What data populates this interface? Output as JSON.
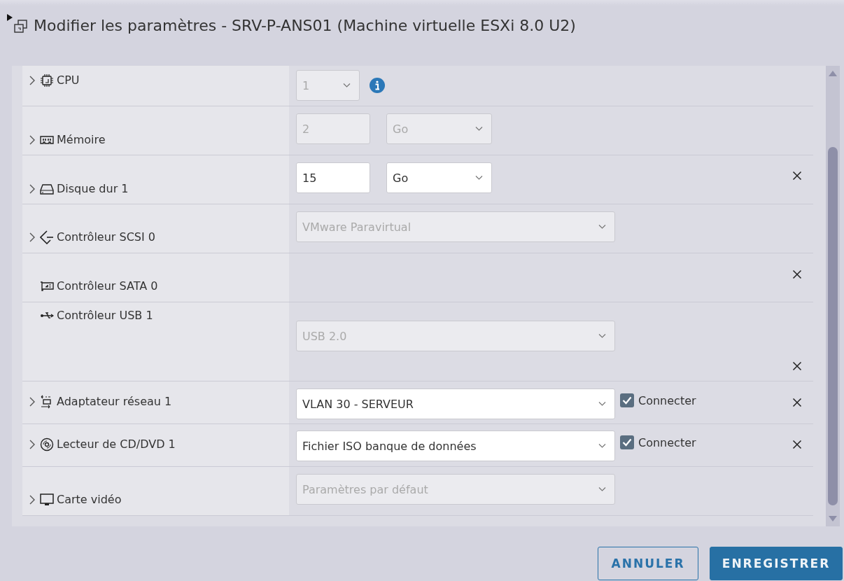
{
  "dialog": {
    "title": "Modifier les paramètres - SRV-P-ANS01 (Machine virtuelle ESXi 8.0 U2)"
  },
  "rows": [
    {
      "label": "CPU",
      "expandable": true,
      "removable": false,
      "controls": [
        {
          "kind": "select",
          "value": "1",
          "disabled": true
        },
        {
          "kind": "info"
        }
      ]
    },
    {
      "label": "Mémoire",
      "expandable": true,
      "removable": false,
      "controls": [
        {
          "kind": "input",
          "value": "2",
          "disabled": true
        },
        {
          "kind": "select",
          "value": "Go",
          "disabled": true
        }
      ]
    },
    {
      "label": "Disque dur 1",
      "expandable": true,
      "removable": true,
      "controls": [
        {
          "kind": "input",
          "value": "15",
          "disabled": false
        },
        {
          "kind": "select",
          "value": "Go",
          "disabled": false
        }
      ]
    },
    {
      "label": "Contrôleur SCSI 0",
      "expandable": true,
      "removable": false,
      "controls": [
        {
          "kind": "select",
          "value": "VMware Paravirtual",
          "disabled": true
        }
      ]
    },
    {
      "label": "Contrôleur SATA 0",
      "expandable": false,
      "removable": true,
      "controls": []
    },
    {
      "label": "Contrôleur USB 1",
      "expandable": false,
      "removable": true,
      "controls": [
        {
          "kind": "select",
          "value": "USB 2.0",
          "disabled": true
        }
      ]
    },
    {
      "label": "Adaptateur réseau 1",
      "expandable": true,
      "removable": true,
      "controls": [
        {
          "kind": "select",
          "value": "VLAN 30 - SERVEUR",
          "disabled": false
        },
        {
          "kind": "checkbox",
          "label": "Connecter",
          "checked": true
        }
      ]
    },
    {
      "label": "Lecteur de CD/DVD 1",
      "expandable": true,
      "removable": true,
      "controls": [
        {
          "kind": "select",
          "value": "Fichier ISO banque de données",
          "disabled": false
        },
        {
          "kind": "checkbox",
          "label": "Connecter",
          "checked": true
        }
      ]
    },
    {
      "label": "Carte vidéo",
      "expandable": true,
      "removable": false,
      "controls": [
        {
          "kind": "select",
          "value": "Paramètres par défaut",
          "disabled": true
        }
      ]
    }
  ],
  "buttons": [
    {
      "label": "ANNULER",
      "kind": "secondary"
    },
    {
      "label": "ENREGISTRER",
      "kind": "primary"
    }
  ]
}
